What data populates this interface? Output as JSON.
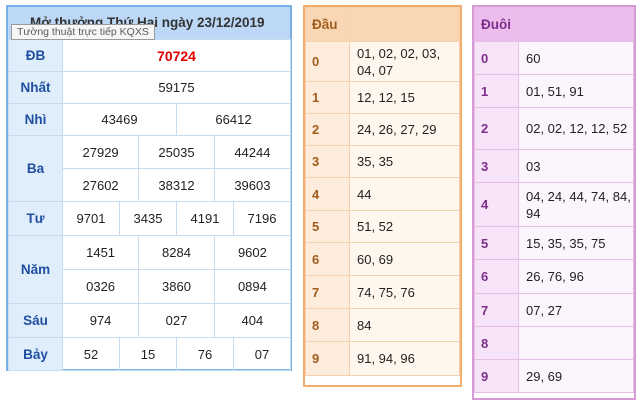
{
  "results": {
    "title": "Mở thưởng Thứ Hai ngày 23/12/2019",
    "tooltip": "Tường thuật trực tiếp KQXS",
    "db_label": "ĐB",
    "db": "70724",
    "nhat_label": "Nhất",
    "nhat": "59175",
    "nhi_label": "Nhì",
    "nhi": [
      "43469",
      "66412"
    ],
    "ba_label": "Ba",
    "ba": [
      "27929",
      "25035",
      "44244",
      "27602",
      "38312",
      "39603"
    ],
    "tu_label": "Tư",
    "tu": [
      "9701",
      "3435",
      "4191",
      "7196"
    ],
    "nam_label": "Năm",
    "nam": [
      "1451",
      "8284",
      "9602",
      "0326",
      "3860",
      "0894"
    ],
    "sau_label": "Sáu",
    "sau": [
      "974",
      "027",
      "404"
    ],
    "bay_label": "Bảy",
    "bay": [
      "52",
      "15",
      "76",
      "07"
    ]
  },
  "dau": {
    "header": "Đầu",
    "rows": [
      {
        "d": "0",
        "v": "01, 02, 02, 03, 04, 07"
      },
      {
        "d": "1",
        "v": "12, 12, 15"
      },
      {
        "d": "2",
        "v": "24, 26, 27, 29"
      },
      {
        "d": "3",
        "v": "35, 35"
      },
      {
        "d": "4",
        "v": "44"
      },
      {
        "d": "5",
        "v": "51, 52"
      },
      {
        "d": "6",
        "v": "60, 69"
      },
      {
        "d": "7",
        "v": "74, 75, 76"
      },
      {
        "d": "8",
        "v": "84"
      },
      {
        "d": "9",
        "v": "91, 94, 96"
      }
    ]
  },
  "duoi": {
    "header": "Đuôi",
    "rows": [
      {
        "d": "0",
        "v": "60"
      },
      {
        "d": "1",
        "v": "01, 51, 91"
      },
      {
        "d": "2",
        "v": "02, 02, 12, 12, 52"
      },
      {
        "d": "3",
        "v": "03"
      },
      {
        "d": "4",
        "v": "04, 24, 44, 74, 84, 94"
      },
      {
        "d": "5",
        "v": "15, 35, 35, 75"
      },
      {
        "d": "6",
        "v": "26, 76, 96"
      },
      {
        "d": "7",
        "v": "07, 27"
      },
      {
        "d": "8",
        "v": ""
      },
      {
        "d": "9",
        "v": "29, 69"
      }
    ]
  },
  "colors": {
    "results_border": "#7ab0e8",
    "special_prize": "#e00000",
    "dau_border": "#f3ac6a",
    "duoi_border": "#d69ad6"
  }
}
